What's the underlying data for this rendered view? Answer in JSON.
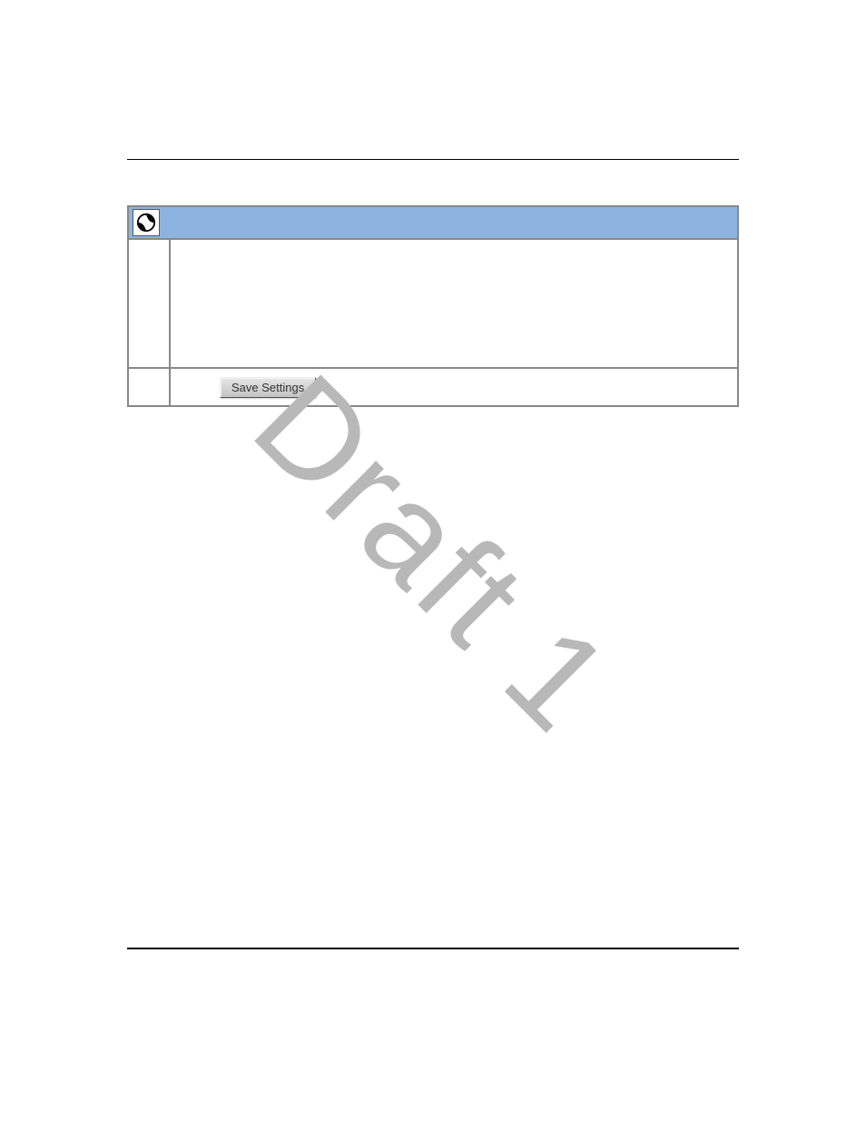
{
  "panel": {
    "save_label": "Save Settings"
  },
  "watermark": "Draft 1"
}
